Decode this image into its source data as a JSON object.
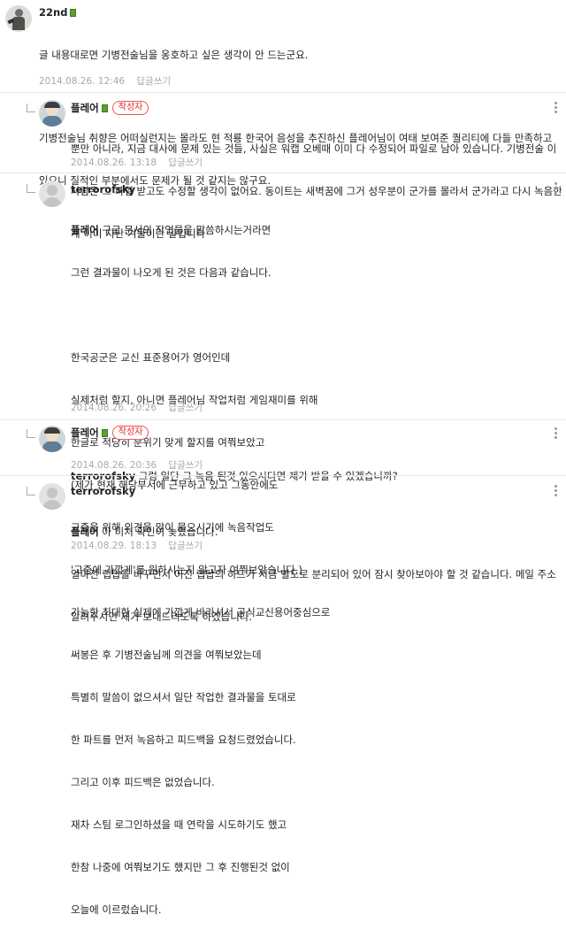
{
  "comments": [
    {
      "author": "22nd",
      "lines": [
        "글 내용대로면 기병전술님을 옹호하고 싶은 생각이 안 드는군요.",
        "",
        "기병전술님 취향은 어떠실런지는 몰라도 현 적룡 한국어 음성을 추진하신 플레어님이 여태 보여준 퀄리티에 다들 만족하고",
        "있으니 질적인 부분에서도 문제가 될 것 같지는 않구요."
      ],
      "date": "2014.08.26. 12:46",
      "reply_label": "답글쓰기"
    },
    {
      "author": "플레어",
      "badge": "작성자",
      "lines": [
        "뿐만 아니라, 지금 대사에 문제 있는 것들, 사실은 워캡 오베때 이미 다 수정되어 파일로 남아 있습니다. 기병전술 이",
        "사람은 그 파일 받고도 수정할 생각이 없어요. 동이트는 새벽꿈에 그거 성우분이 군가를 몰라서 군가라고 다시 녹음한",
        "게 이미 지난 겨울이란 말입니다"
      ],
      "date": "2014.08.26. 13:18",
      "reply_label": "답글쓰기"
    },
    {
      "author": "terrorofsky",
      "mention": "플레어",
      "lines": [
        " 구글 문서의 작업물을 말씀하시는거라면",
        "그런 결과물이 나오게 된 것은 다음과 같습니다.",
        "",
        "한국공군은 교신 표준용어가 영어인데",
        "실제처럼 할지, 아니면 플레어님 작업처럼 게임재미를 위해",
        "한글로 적당히 분위기 맞게 할지를 여쭤보았고",
        "(제가 현재 해당부서에 근무하고 있고 그동안에도",
        "고증을 위해 의견을 많이 물으시기에 녹음작업도",
        "'고증에 가깝게'를 원하시는지 알고자 여쭤보았습니다.)",
        "가능한 최대한 실제에 가깝게 바라셔서 공식교신용어중심으로",
        "써봉은 후 기병전술님께 의견을 여쭤보았는데",
        "특별히 말씀이 없으셔서 일단 작업한 결과물을 토대로",
        "한 파트를 먼저 녹음하고 피드백을 요청드렸었습니다.",
        "그리고 이후 피드백은 없었습니다.",
        "재차 스팀 로그인하셨을 때 연락을 시도하기도 했고",
        "한참 나중에 여쭤보기도 했지만 그 후 진행된것 없이",
        "오늘에 이르렀습니다."
      ],
      "date": "2014.08.26. 20:26",
      "reply_label": "답글쓰기"
    },
    {
      "author": "플레어",
      "badge": "작성자",
      "mention": "terrorofsky",
      "lines": [
        " 그럼 일단 그 녹음 된것 있으시다면 제가 받을 수 있겠습니까?"
      ],
      "date": "2014.08.26. 20:36",
      "reply_label": "답글쓰기"
    },
    {
      "author": "terrorofsky",
      "mention": "플레어",
      "lines": [
        " 아 미처 확인이 늦었습니다.",
        "얼마전 랩탑을 바꾸면서 이전 랩탑의 하드가 지금 별도로 분리되어 있어 잠시 찾아보아야 할 것 같습니다. 메일 주소",
        "알려주시면 제가 보내드리도록 하겠습니다."
      ],
      "date": "2014.08.29. 18:13",
      "reply_label": "답글쓰기"
    }
  ]
}
